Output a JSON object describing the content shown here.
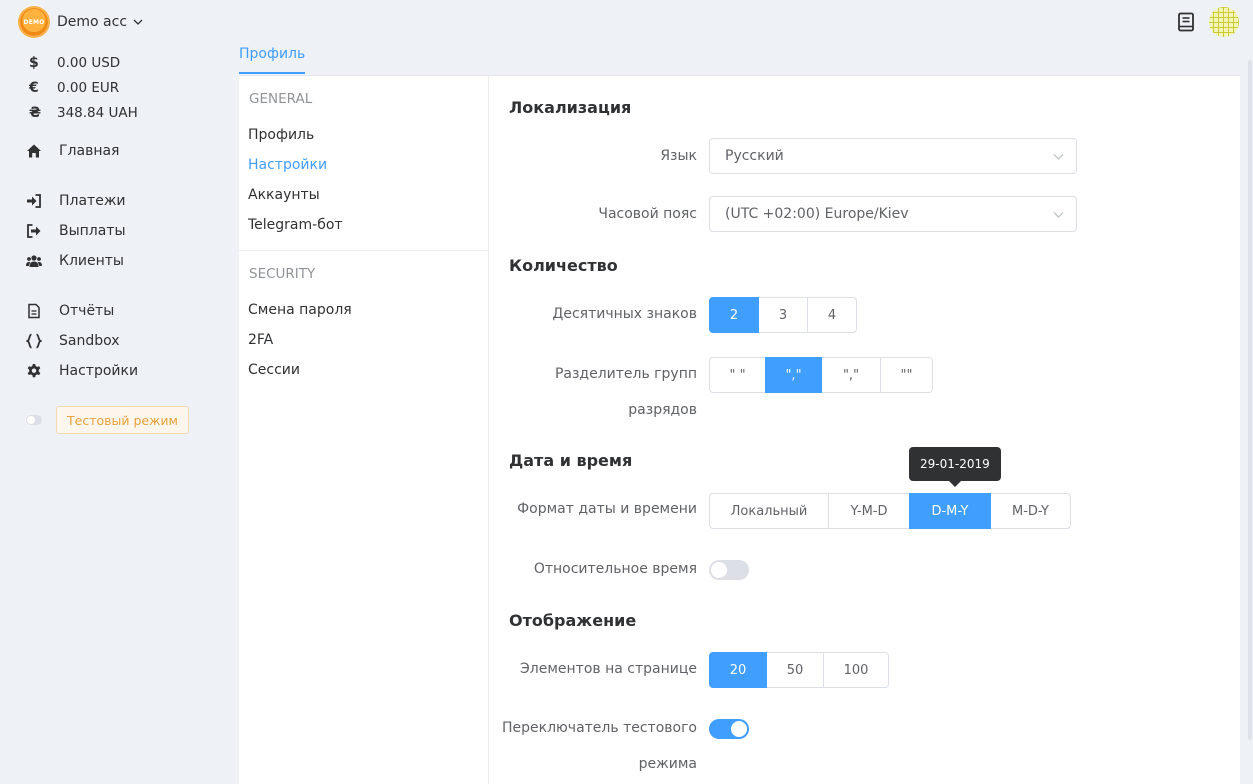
{
  "account": {
    "logo_text": "DEMO",
    "name": "Demo acc"
  },
  "balances": [
    {
      "symbol": "$",
      "amount": "0.00 USD"
    },
    {
      "symbol": "€",
      "amount": "0.00 EUR"
    },
    {
      "symbol": "₴",
      "amount": "348.84 UAH"
    }
  ],
  "nav": {
    "home": "Главная",
    "payments": "Платежи",
    "payouts": "Выплаты",
    "clients": "Клиенты",
    "reports": "Отчёты",
    "sandbox": "Sandbox",
    "settings": "Настройки",
    "test_mode": "Тестовый режим"
  },
  "tabs": {
    "profile": "Профиль"
  },
  "subnav": {
    "general_head": "GENERAL",
    "general": [
      "Профиль",
      "Настройки",
      "Аккаунты",
      "Telegram-бот"
    ],
    "security_head": "SECURITY",
    "security": [
      "Смена пароля",
      "2FA",
      "Сессии"
    ]
  },
  "sections": {
    "localization": "Локализация",
    "quantity": "Количество",
    "datetime": "Дата и время",
    "display": "Отображение"
  },
  "fields": {
    "language_label": "Язык",
    "language_value": "Русский",
    "timezone_label": "Часовой пояс",
    "timezone_value": "(UTC +02:00) Europe/Kiev",
    "decimals_label": "Десятичных знаков",
    "decimals_options": [
      "2",
      "3",
      "4"
    ],
    "decimals_selected": "2",
    "group_sep_label_1": "Разделитель групп",
    "group_sep_label_2": "разрядов",
    "group_sep_options": [
      "\" \"",
      "\",\"",
      "\",\"",
      "\"\""
    ],
    "group_sep_selected_index": 1,
    "date_format_label": "Формат даты и времени",
    "date_format_options": [
      "Локальный",
      "Y-M-D",
      "D-M-Y",
      "M-D-Y"
    ],
    "date_format_selected": "D-M-Y",
    "date_format_tooltip": "29-01-2019",
    "relative_time_label": "Относительное время",
    "relative_time_on": false,
    "per_page_label": "Элементов на странице",
    "per_page_options": [
      "20",
      "50",
      "100"
    ],
    "per_page_selected": "20",
    "test_switch_label_1": "Переключатель тестового",
    "test_switch_label_2": "режима",
    "test_switch_on": true
  },
  "colors": {
    "accent": "#409eff",
    "warning": "#e6a23c"
  }
}
